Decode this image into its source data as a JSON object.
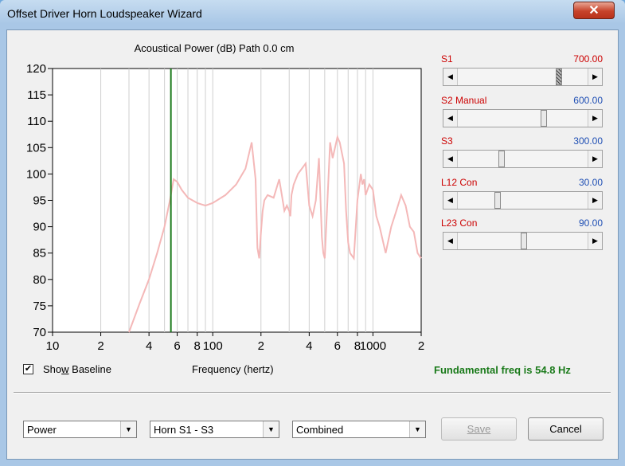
{
  "window": {
    "title": "Offset Driver Horn Loudspeaker Wizard",
    "close_glyph": "✕"
  },
  "plot": {
    "title": "Acoustical Power (dB)   Path 0.0 cm",
    "xlabel": "Frequency (hertz)",
    "y_ticks": [
      "120",
      "115",
      "110",
      "105",
      "100",
      "95",
      "90",
      "85",
      "80",
      "75",
      "70"
    ],
    "x_ticks": [
      "10",
      "2",
      "4",
      "6",
      "8",
      "100",
      "2",
      "4",
      "6",
      "8",
      "1000",
      "2"
    ]
  },
  "chart_data": {
    "type": "line",
    "title": "Acoustical Power (dB)   Path 0.0 cm",
    "xlabel": "Frequency (hertz)",
    "ylabel": "",
    "x_scale": "log",
    "xlim": [
      10,
      2000
    ],
    "ylim": [
      70,
      120
    ],
    "marker_line_hz": 54.8,
    "series": [
      {
        "color": "#f4b8b8",
        "x": [
          30,
          35,
          40,
          45,
          50,
          54,
          57,
          60,
          64,
          70,
          80,
          90,
          100,
          120,
          140,
          160,
          175,
          185,
          190,
          195,
          200,
          205,
          210,
          220,
          240,
          260,
          270,
          280,
          290,
          300,
          305,
          310,
          320,
          340,
          380,
          400,
          420,
          440,
          460,
          480,
          490,
          500,
          520,
          540,
          560,
          580,
          600,
          620,
          640,
          660,
          680,
          700,
          720,
          760,
          800,
          840,
          860,
          880,
          900,
          950,
          1000,
          1050,
          1100,
          1200,
          1300,
          1400,
          1500,
          1600,
          1700,
          1800,
          1900,
          2000
        ],
        "y": [
          70,
          75.5,
          80,
          85,
          90,
          95,
          99,
          98.5,
          97,
          95.5,
          94.5,
          94,
          94.5,
          96,
          98,
          101,
          106,
          99,
          86,
          84,
          89,
          93,
          95,
          96,
          95.5,
          99,
          96,
          93,
          94,
          93,
          92,
          96,
          98,
          100,
          102,
          94,
          92,
          95,
          103,
          88,
          85,
          84,
          95,
          106,
          103,
          105,
          107,
          106,
          104,
          102,
          93,
          87,
          85,
          84,
          95,
          100,
          98,
          99,
          96,
          98,
          97,
          92,
          90,
          85,
          90,
          93,
          96,
          94,
          90,
          89,
          85,
          84
        ]
      }
    ]
  },
  "sliders": [
    {
      "label": "S1",
      "value": "700.00",
      "value_color": "red",
      "level": 0.79,
      "hatched": true
    },
    {
      "label": "S2  Manual",
      "value": "600.00",
      "value_color": "blue",
      "level": 0.67,
      "hatched": false
    },
    {
      "label": "S3",
      "value": "300.00",
      "value_color": "blue",
      "level": 0.33,
      "hatched": false
    },
    {
      "label": "L12  Con",
      "value": "30.00",
      "value_color": "blue",
      "level": 0.3,
      "hatched": false
    },
    {
      "label": "L23  Con",
      "value": "90.00",
      "value_color": "blue",
      "level": 0.51,
      "hatched": false
    }
  ],
  "show_baseline": {
    "label_pre": "Sho",
    "label_u": "w",
    "label_post": " Baseline",
    "checked": true,
    "check_glyph": "✔"
  },
  "status": "Fundamental freq is 54.8 Hz",
  "combos": {
    "mode": "Power",
    "horn": "Horn S1 - S3",
    "output": "Combined",
    "arrow": "▼"
  },
  "buttons": {
    "save": "Save",
    "cancel": "Cancel"
  },
  "arrows": {
    "left": "◀",
    "right": "▶"
  }
}
